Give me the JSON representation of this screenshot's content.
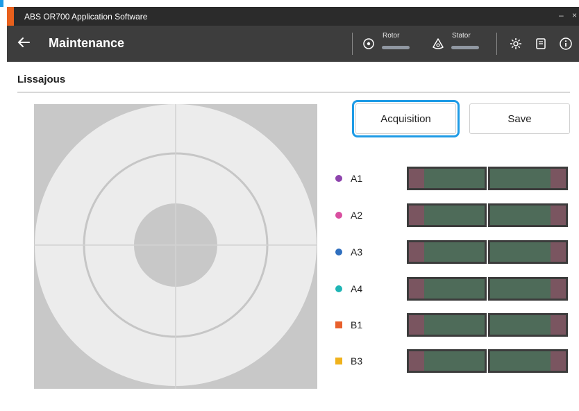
{
  "window": {
    "title": "ABS OR700 Application Software",
    "minimize": "–",
    "close": "×"
  },
  "appbar": {
    "page_title": "Maintenance",
    "rotor_label": "Rotor",
    "stator_label": "Stator",
    "icons": [
      "back-arrow-icon",
      "rotor-icon",
      "stator-icon",
      "settings-icon",
      "manual-icon",
      "info-icon"
    ]
  },
  "section": {
    "title": "Lissajous"
  },
  "buttons": {
    "acquisition": "Acquisition",
    "save": "Save"
  },
  "channels": [
    {
      "label": "A1",
      "color": "#8e44ad",
      "shape": "dot"
    },
    {
      "label": "A2",
      "color": "#d94fa0",
      "shape": "dot"
    },
    {
      "label": "A3",
      "color": "#2f6fbf",
      "shape": "dot"
    },
    {
      "label": "A4",
      "color": "#1fb5b5",
      "shape": "dot"
    },
    {
      "label": "B1",
      "color": "#e8602c",
      "shape": "square"
    },
    {
      "label": "B3",
      "color": "#f0b21c",
      "shape": "square"
    }
  ],
  "colors": {
    "accent": "#e8601c",
    "focus": "#1e9be6",
    "bar_green": "#4e6b59",
    "bar_red": "#7a5560"
  }
}
